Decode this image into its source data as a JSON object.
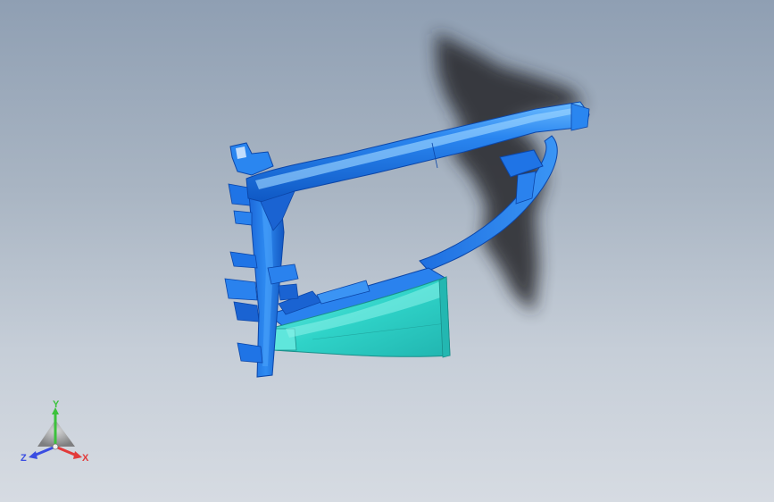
{
  "viewport": {
    "background_top": "#8f9fb3",
    "background_bottom": "#d6dbe2",
    "model": {
      "frame_color": "#1f74e6",
      "frame_highlight": "#5fb0ff",
      "frame_dark": "#0d4fb8",
      "cone_color": "#2fd3c8",
      "cone_highlight": "#7ff0e6",
      "shadow_color": "#2a2c30"
    }
  },
  "triad": {
    "x_label": "X",
    "y_label": "Y",
    "z_label": "Z",
    "x_color": "#e23a3a",
    "y_color": "#3cc23c",
    "z_color": "#3a4de2"
  }
}
